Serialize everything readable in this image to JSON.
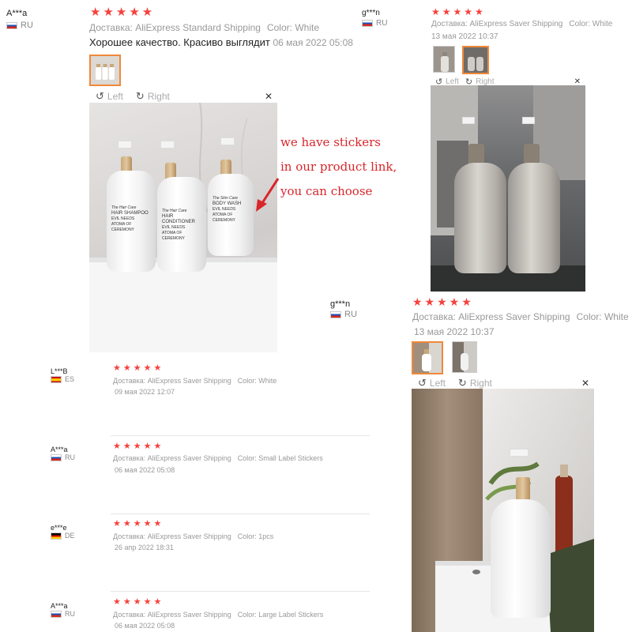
{
  "reviews": {
    "main": {
      "user": "A***a",
      "country": "RU",
      "stars": "★★★★★",
      "shipping": "Доставка: AliExpress Standard Shipping",
      "color": "Color: White",
      "text": "Хорошее качество. Красиво выглядит",
      "date": "06 мая 2022 05:08",
      "viewer": {
        "left": "Left",
        "right": "Right",
        "close": "✕"
      },
      "annotation": [
        "we have stickers",
        "in our product link,",
        "you can choose"
      ],
      "bottle_labels": [
        {
          "brand": "The Hair Care",
          "product": "HAIR SHAMPOO",
          "line1": "EVIL NEEDS",
          "line2": "ATOMA OF CEREMONY"
        },
        {
          "brand": "The Hair Care",
          "product": "HAIR CONDITIONER",
          "line1": "EVIL NEEDS",
          "line2": "ATOMA OF CEREMONY"
        },
        {
          "brand": "The Skin Care",
          "product": "BODY WASH",
          "line1": "EVIL NEEDS",
          "line2": "ATOMA OF CEREMONY"
        }
      ]
    },
    "right_top": {
      "user": "g***n",
      "country": "RU",
      "stars": "★★★★★",
      "shipping": "Доставка: AliExpress Saver Shipping",
      "color": "Color: White",
      "date": "13 мая 2022 10:37",
      "viewer": {
        "left": "Left",
        "right": "Right",
        "close": "✕"
      }
    },
    "right_bottom": {
      "user": "g***n",
      "country": "RU",
      "stars": "★★★★★",
      "shipping": "Доставка: AliExpress Saver Shipping",
      "color": "Color: White",
      "date": "13 мая 2022 10:37",
      "viewer": {
        "left": "Left",
        "right": "Right",
        "close": "✕"
      }
    },
    "list": [
      {
        "user": "L***B",
        "country": "ES",
        "stars": "★★★★★",
        "shipping": "Доставка: AliExpress Saver Shipping",
        "color": "Color: White",
        "date": "09 мая 2022 12:07"
      },
      {
        "user": "A***a",
        "country": "RU",
        "stars": "★★★★★",
        "shipping": "Доставка: AliExpress Saver Shipping",
        "color": "Color: Small Label Stickers",
        "date": "06 мая 2022 05:08"
      },
      {
        "user": "e***e",
        "country": "DE",
        "stars": "★★★★★",
        "shipping": "Доставка: AliExpress Saver Shipping",
        "color": "Color: 1pcs",
        "date": "26 апр 2022 18:31"
      },
      {
        "user": "A***a",
        "country": "RU",
        "stars": "★★★★★",
        "shipping": "Доставка: AliExpress Saver Shipping",
        "color": "Color: Large Label Stickers",
        "date": "06 мая 2022 05:08"
      }
    ]
  },
  "colors": {
    "star": "#f5413d",
    "annotation": "#d8262b",
    "thumb_active": "#f0883a",
    "meta": "#999999"
  }
}
